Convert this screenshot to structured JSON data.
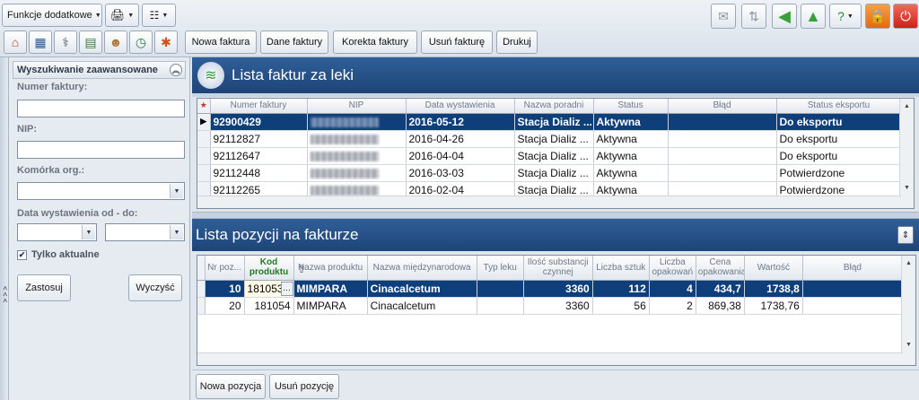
{
  "toolbar": {
    "functions_label": "Funkcje dodatkowe",
    "nav_buttons": [
      "Nowa faktura",
      "Dane faktury",
      "Korekta faktury",
      "Usuń fakturę",
      "Drukuj"
    ],
    "icons": [
      "home-icon",
      "calendar-icon",
      "stethoscope-icon",
      "documents-icon",
      "users-icon",
      "clock-refresh-icon",
      "asterisk-icon"
    ],
    "right_icons": [
      "mail-icon",
      "transfer-icon",
      "back-arrow-icon",
      "home-up-icon",
      "help-icon",
      "lock-icon",
      "power-icon"
    ]
  },
  "search": {
    "title": "Wyszukiwanie zaawansowane",
    "invoice_number_label": "Numer faktury:",
    "invoice_number_value": "",
    "nip_label": "NIP:",
    "nip_value": "",
    "unit_label": "Komórka org.:",
    "unit_value": "",
    "date_label": "Data wystawienia od - do:",
    "date_from": "",
    "date_to": "",
    "only_current_label": "Tylko aktualne",
    "only_current_checked": true,
    "apply_label": "Zastosuj",
    "clear_label": "Wyczyść",
    "collapse_arrows": "< < <"
  },
  "invoices": {
    "title": "Lista faktur za leki",
    "columns": [
      "Numer faktury",
      "NIP",
      "Data wystawienia",
      "Nazwa poradni",
      "Status",
      "Błąd",
      "Status eksportu"
    ],
    "rows": [
      {
        "number": "92900429",
        "date": "2016-05-12",
        "clinic": "Stacja Dializ ...",
        "status": "Aktywna",
        "error": "",
        "export": "Do eksportu",
        "selected": true
      },
      {
        "number": "92112827",
        "date": "2016-04-26",
        "clinic": "Stacja Dializ ...",
        "status": "Aktywna",
        "error": "",
        "export": "Do eksportu",
        "selected": false
      },
      {
        "number": "92112647",
        "date": "2016-04-04",
        "clinic": "Stacja Dializ ...",
        "status": "Aktywna",
        "error": "",
        "export": "Do eksportu",
        "selected": false
      },
      {
        "number": "92112448",
        "date": "2016-03-03",
        "clinic": "Stacja Dializ ...",
        "status": "Aktywna",
        "error": "",
        "export": "Potwierdzone",
        "selected": false
      },
      {
        "number": "92112265",
        "date": "2016-02-04",
        "clinic": "Stacja Dializ ...",
        "status": "Aktywna",
        "error": "",
        "export": "Potwierdzone",
        "selected": false
      }
    ]
  },
  "positions": {
    "title": "Lista pozycji na fakturze",
    "columns": [
      "Nr poz...",
      "Kod produktu",
      "Nazwa produktu",
      "Nazwa międzynarodowa",
      "Typ leku",
      "Ilość substancji czynnej",
      "Liczba sztuk",
      "Liczba opakowań",
      "Cena opakowania",
      "Wartość",
      "Błąd"
    ],
    "rows": [
      {
        "nr": "10",
        "code": "181053",
        "product": "MIMPARA",
        "intl": "Cinacalcetum",
        "type": "",
        "qty": "3360",
        "pieces": "112",
        "packs": "4",
        "price": "434,7",
        "value": "1738,8",
        "error": "",
        "selected": true
      },
      {
        "nr": "20",
        "code": "181054",
        "product": "MIMPARA",
        "intl": "Cinacalcetum",
        "type": "",
        "qty": "3360",
        "pieces": "56",
        "packs": "2",
        "price": "869,38",
        "value": "1738,76",
        "error": "",
        "selected": false
      }
    ],
    "add_label": "Nowa pozycja",
    "remove_label": "Usuń pozycję"
  }
}
